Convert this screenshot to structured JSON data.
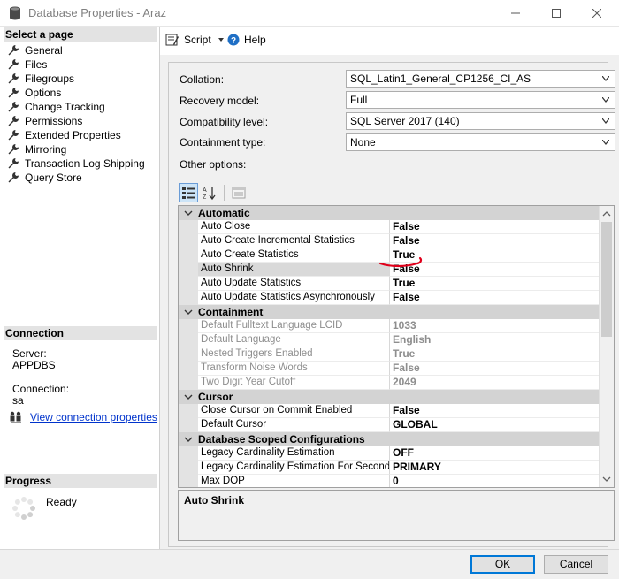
{
  "window": {
    "title": "Database Properties - Araz"
  },
  "left": {
    "select_page_header": "Select a page",
    "pages": [
      {
        "label": "General",
        "name": "general"
      },
      {
        "label": "Files",
        "name": "files"
      },
      {
        "label": "Filegroups",
        "name": "filegroups"
      },
      {
        "label": "Options",
        "name": "options"
      },
      {
        "label": "Change Tracking",
        "name": "change-tracking"
      },
      {
        "label": "Permissions",
        "name": "permissions"
      },
      {
        "label": "Extended Properties",
        "name": "extended-properties"
      },
      {
        "label": "Mirroring",
        "name": "mirroring"
      },
      {
        "label": "Transaction Log Shipping",
        "name": "transaction-log-shipping"
      },
      {
        "label": "Query Store",
        "name": "query-store"
      }
    ],
    "connection_header": "Connection",
    "server_label": "Server:",
    "server_value": "APPDBS",
    "connection_label": "Connection:",
    "connection_value": "sa",
    "view_connection_link": "View connection properties",
    "progress_header": "Progress",
    "progress_status": "Ready"
  },
  "toolbar": {
    "script_label": "Script",
    "help_label": "Help"
  },
  "form": {
    "collation_label": "Collation:",
    "collation_value": "SQL_Latin1_General_CP1256_CI_AS",
    "recovery_label": "Recovery model:",
    "recovery_value": "Full",
    "compat_label": "Compatibility level:",
    "compat_value": "SQL Server 2017 (140)",
    "containment_label": "Containment type:",
    "containment_value": "None",
    "other_options_label": "Other options:"
  },
  "grid": {
    "categories": [
      {
        "label": "Automatic",
        "rows": [
          {
            "name": "Auto Close",
            "value": "False"
          },
          {
            "name": "Auto Create Incremental Statistics",
            "value": "False"
          },
          {
            "name": "Auto Create Statistics",
            "value": "True"
          },
          {
            "name": "Auto Shrink",
            "value": "False",
            "selected": true
          },
          {
            "name": "Auto Update Statistics",
            "value": "True"
          },
          {
            "name": "Auto Update Statistics Asynchronously",
            "value": "False"
          }
        ]
      },
      {
        "label": "Containment",
        "rows": [
          {
            "name": "Default Fulltext Language LCID",
            "value": "1033",
            "disabled": true
          },
          {
            "name": "Default Language",
            "value": "English",
            "disabled": true
          },
          {
            "name": "Nested Triggers Enabled",
            "value": "True",
            "disabled": true
          },
          {
            "name": "Transform Noise Words",
            "value": "False",
            "disabled": true
          },
          {
            "name": "Two Digit Year Cutoff",
            "value": "2049",
            "disabled": true
          }
        ]
      },
      {
        "label": "Cursor",
        "rows": [
          {
            "name": "Close Cursor on Commit Enabled",
            "value": "False"
          },
          {
            "name": "Default Cursor",
            "value": "GLOBAL"
          }
        ]
      },
      {
        "label": "Database Scoped Configurations",
        "rows": [
          {
            "name": "Legacy Cardinality Estimation",
            "value": "OFF"
          },
          {
            "name": "Legacy Cardinality Estimation For Secondary",
            "value": "PRIMARY"
          },
          {
            "name": "Max DOP",
            "value": "0"
          }
        ]
      }
    ],
    "description_title": "Auto Shrink"
  },
  "buttons": {
    "ok": "OK",
    "cancel": "Cancel"
  },
  "colors": {
    "annotation": "#e0001b",
    "link": "#0033cc",
    "ok_border": "#0078d7"
  }
}
